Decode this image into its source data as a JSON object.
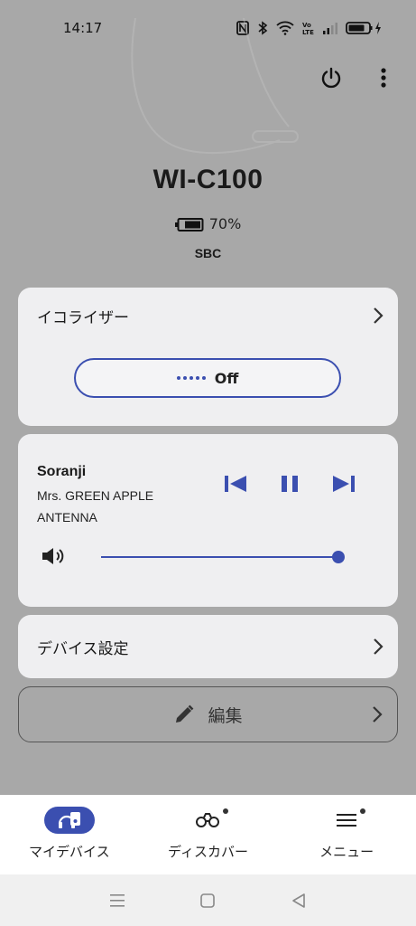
{
  "status_bar": {
    "time": "14:17",
    "icons": [
      "nfc-icon",
      "bluetooth-icon",
      "wifi-icon",
      "volte-icon",
      "signal-icon",
      "battery-charging-icon"
    ]
  },
  "header": {
    "device_name": "WI-C100",
    "battery_text": "70%",
    "battery_level": 0.7,
    "codec": "SBC",
    "actions": [
      "power-icon",
      "more-vert-icon"
    ]
  },
  "equalizer": {
    "title": "イコライザー",
    "button_label": "Off"
  },
  "player": {
    "title": "Soranji",
    "artist": "Mrs. GREEN APPLE",
    "album": "ANTENNA",
    "volume_level": 0.98
  },
  "device_settings": {
    "title": "デバイス設定"
  },
  "edit": {
    "label": "編集"
  },
  "bottom_nav": {
    "items": [
      {
        "label": "マイデバイス",
        "icon": "headphones-device-icon",
        "active": true
      },
      {
        "label": "ディスカバー",
        "icon": "binoculars-icon",
        "badge": true
      },
      {
        "label": "メニュー",
        "icon": "menu-icon",
        "badge": true
      }
    ]
  },
  "colors": {
    "accent": "#3b4fb0",
    "background": "#a8a8a8",
    "card": "#efeff1"
  }
}
